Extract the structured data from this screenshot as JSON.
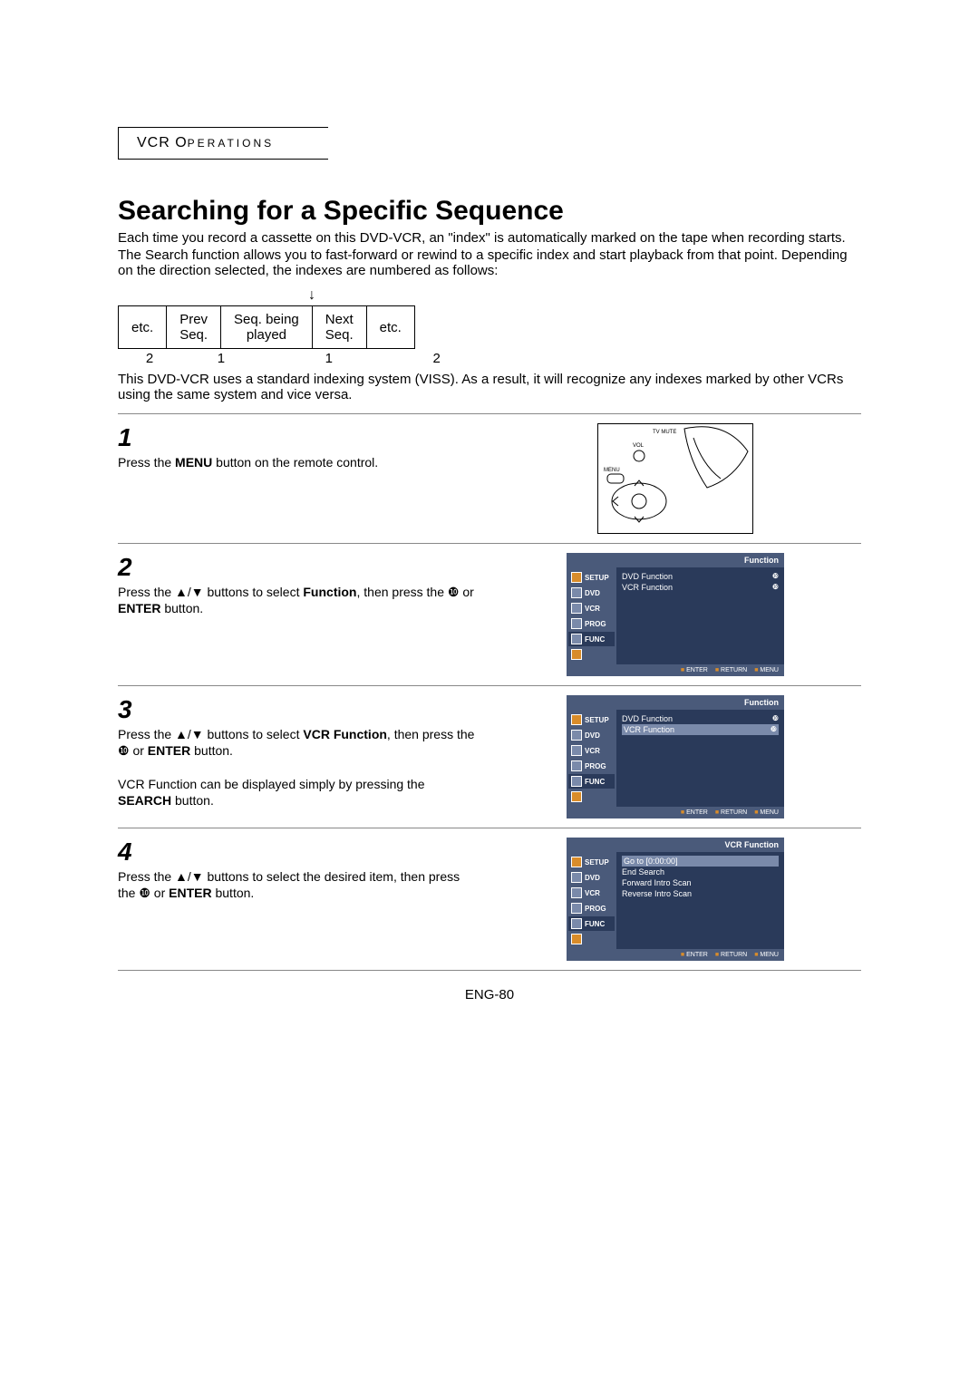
{
  "section_label_prefix": "VCR O",
  "section_label_rest": "PERATIONS",
  "title": "Searching for a Specific Sequence",
  "intro": {
    "p1": "Each time you record a cassette on this DVD-VCR, an \"index\" is automatically marked on the tape when recording starts.",
    "p2": "The Search function allows you to fast-forward or rewind to a specific index and start playback from that point. Depending on the direction selected, the indexes are numbered as follows:"
  },
  "seq_arrow": "↓",
  "seq_table": {
    "c1": "etc.",
    "c2a": "Prev",
    "c2b": "Seq.",
    "c3a": "Seq. being",
    "c3b": "played",
    "c4a": "Next",
    "c4b": "Seq.",
    "c5": "etc."
  },
  "seq_nums": {
    "n1": "2",
    "n2": "1",
    "n3": "1",
    "n4": "2"
  },
  "note": "This DVD-VCR uses a standard indexing system (VISS). As a result, it will recognize any indexes marked by other VCRs using the same system and vice versa.",
  "steps": {
    "s1": {
      "num": "1",
      "pre": "Press the ",
      "bold": "MENU",
      "post": " button on the remote control."
    },
    "s2": {
      "num": "2",
      "pre": "Press the ▲/▼ buttons to select ",
      "bold": "Function",
      "mid1": ", then press the ❿ or ",
      "bold2": "ENTER",
      "post": " button."
    },
    "s3": {
      "num": "3",
      "pre": "Press the ▲/▼ buttons to select ",
      "bold": "VCR Function",
      "mid1": ", then press the ❿ or ",
      "bold2": "ENTER",
      "post": " button.",
      "extra_pre": "VCR Function can be displayed simply by pressing the ",
      "extra_bold": "SEARCH",
      "extra_post": " button."
    },
    "s4": {
      "num": "4",
      "pre": "Press the ▲/▼ buttons to select the desired item, then press the ❿ or ",
      "bold": "ENTER",
      "post": " button."
    }
  },
  "osd": {
    "header_function": "Function",
    "header_vcr": "VCR Function",
    "side": {
      "setup": "SETUP",
      "dvd": "DVD",
      "vcr": "VCR",
      "prog": "PROG",
      "func": "FUNC"
    },
    "rows_a": {
      "r1": "DVD Function",
      "r2": "VCR Function"
    },
    "rows_b": {
      "r1": "Go to [0:00:00]",
      "r2": "End Search",
      "r3": "Forward Intro Scan",
      "r4": "Reverse Intro Scan"
    },
    "foot": {
      "enter": "ENTER",
      "ret": "RETURN",
      "menu": "MENU"
    },
    "tri": "❿"
  },
  "remote_labels": {
    "tvmute": "TV MUTE",
    "vol": "VOL",
    "menu": "MENU"
  },
  "page_foot": "ENG-80"
}
